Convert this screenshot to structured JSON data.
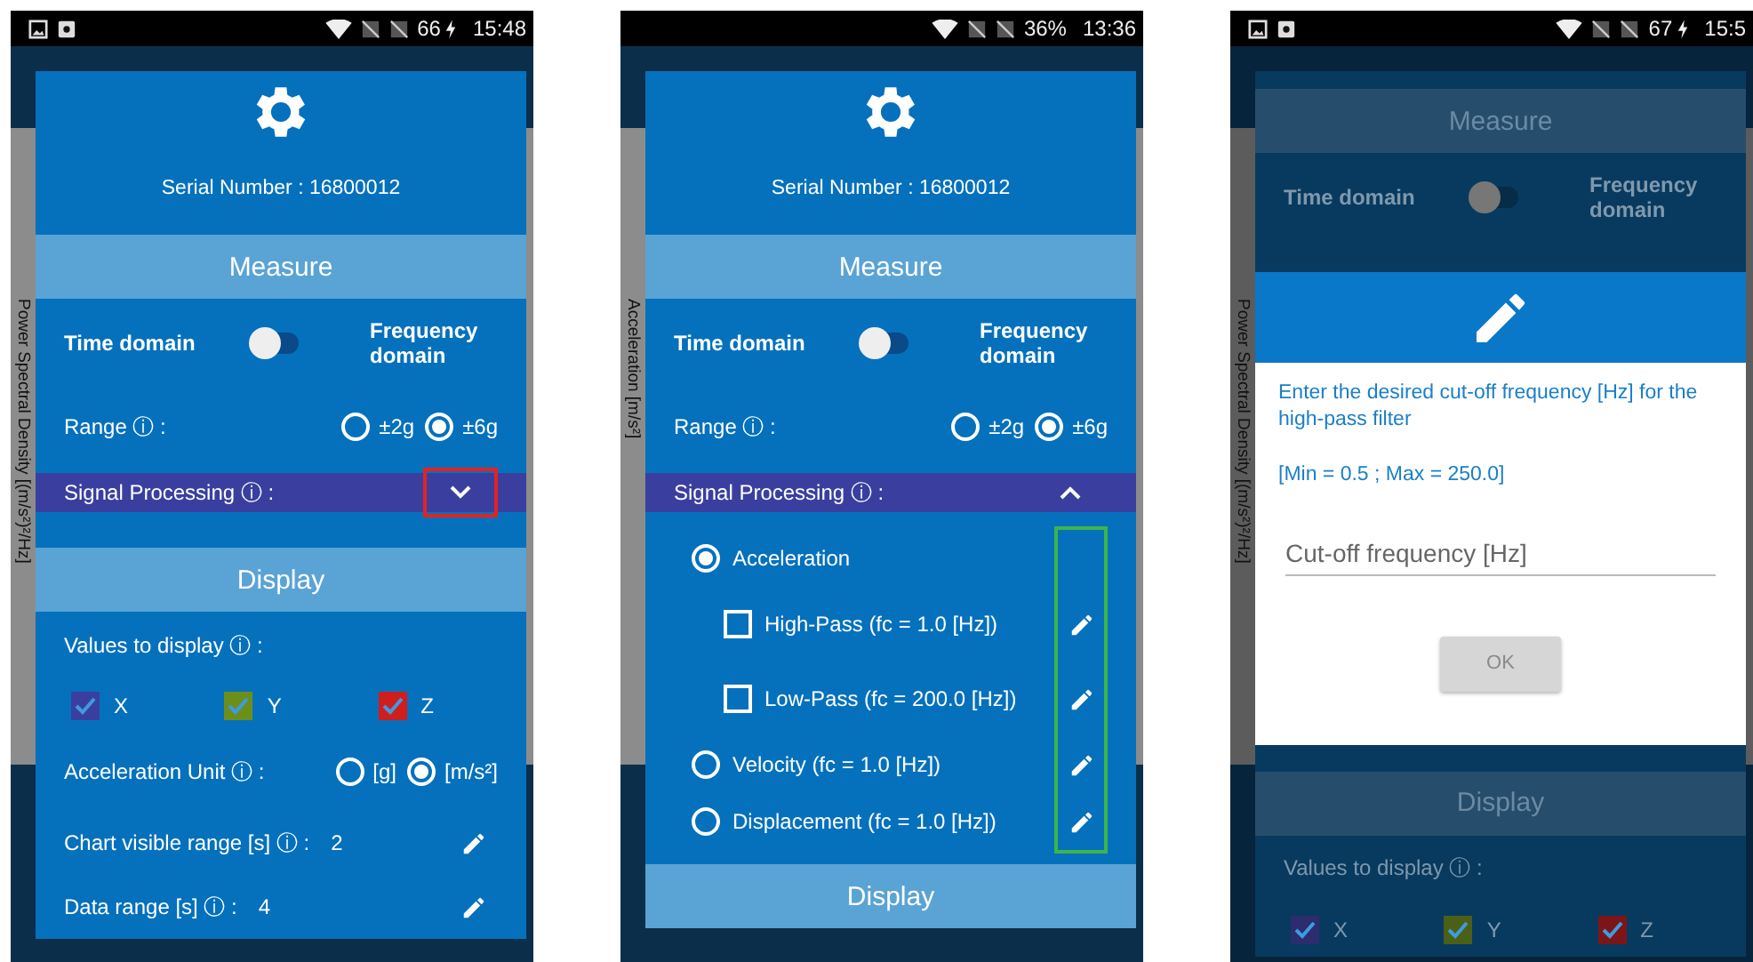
{
  "phones": [
    {
      "status": {
        "notification_icons": true,
        "battery": "66",
        "charging": true,
        "time": "15:48"
      },
      "axis_label": "Power Spectral Density [(m/s²)²/Hz]",
      "dimmed": false,
      "serial": "Serial Number : 16800012",
      "items": [
        {
          "kind": "header",
          "text": "Measure"
        },
        {
          "kind": "toggle",
          "left": "Time domain",
          "right": "Frequency domain",
          "on": false
        },
        {
          "kind": "radio_row",
          "label": "Range ⓘ :",
          "options": [
            {
              "label": "±2g",
              "selected": false
            },
            {
              "label": "±6g",
              "selected": true
            }
          ]
        },
        {
          "kind": "expander",
          "label": "Signal Processing ⓘ :",
          "expanded": false,
          "highlighted": true
        },
        {
          "kind": "header",
          "text": "Display"
        },
        {
          "kind": "label",
          "text": "Values to display ⓘ :"
        },
        {
          "kind": "checks",
          "items": [
            {
              "label": "X",
              "checked": true,
              "color": "#3a3f9f"
            },
            {
              "label": "Y",
              "checked": true,
              "color": "#6c8f1c"
            },
            {
              "label": "Z",
              "checked": true,
              "color": "#d01d1d"
            }
          ]
        },
        {
          "kind": "radio_row",
          "label": "Acceleration Unit ⓘ :",
          "options": [
            {
              "label": "[g]",
              "selected": false
            },
            {
              "label": "[m/s²]",
              "selected": true
            }
          ]
        },
        {
          "kind": "value",
          "label": "Chart visible range [s] ⓘ :",
          "value": "2",
          "editable": true
        },
        {
          "kind": "value",
          "label": "Data range [s] ⓘ :",
          "value": "4",
          "editable": true
        }
      ]
    },
    {
      "status": {
        "notification_icons": false,
        "battery": "36%",
        "charging": false,
        "time": "13:36"
      },
      "axis_label": "Acceleration [m/s²]",
      "dimmed": false,
      "serial": "Serial Number : 16800012",
      "items": [
        {
          "kind": "header",
          "text": "Measure"
        },
        {
          "kind": "toggle",
          "left": "Time domain",
          "right": "Frequency domain",
          "on": false
        },
        {
          "kind": "radio_row",
          "label": "Range ⓘ :",
          "options": [
            {
              "label": "±2g",
              "selected": false
            },
            {
              "label": "±6g",
              "selected": true
            }
          ]
        },
        {
          "kind": "expander",
          "label": "Signal Processing ⓘ :",
          "expanded": true,
          "highlighted": false,
          "edit_highlighted": true,
          "children": [
            {
              "kind": "radio",
              "label": "Acceleration",
              "selected": true,
              "editable": false
            },
            {
              "kind": "check",
              "label": "High-Pass (fc = 1.0 [Hz])",
              "checked": false,
              "editable": true
            },
            {
              "kind": "check",
              "label": "Low-Pass (fc = 200.0 [Hz])",
              "checked": false,
              "editable": true
            },
            {
              "kind": "radio",
              "label": "Velocity (fc = 1.0 [Hz])",
              "selected": false,
              "editable": true
            },
            {
              "kind": "radio",
              "label": "Displacement (fc = 1.0 [Hz])",
              "selected": false,
              "editable": true
            }
          ]
        },
        {
          "kind": "header",
          "text": "Display"
        }
      ]
    },
    {
      "status": {
        "notification_icons": true,
        "battery": "67",
        "charging": true,
        "time": "15:5"
      },
      "axis_label": "Power Spectral Density [(m/s²)²/Hz]",
      "dimmed": true,
      "items": [
        {
          "kind": "header",
          "text": "Measure"
        },
        {
          "kind": "toggle",
          "left": "Time domain",
          "right": "Frequency domain",
          "on": false
        },
        {
          "kind": "popup",
          "message": "Enter the desired cut-off frequency [Hz] for the high-pass filter",
          "limits": "[Min = 0.5 ; Max = 250.0]",
          "placeholder": "Cut-off frequency [Hz]",
          "button": {
            "label": "OK",
            "disabled": true
          }
        },
        {
          "kind": "header",
          "text": "Display"
        },
        {
          "kind": "label",
          "text": "Values to display ⓘ :"
        },
        {
          "kind": "checks",
          "items": [
            {
              "label": "X",
              "checked": true,
              "color": "#2c2c6e"
            },
            {
              "label": "Y",
              "checked": true,
              "color": "#4c5f16"
            },
            {
              "label": "Z",
              "checked": true,
              "color": "#7c1616"
            }
          ]
        }
      ]
    }
  ]
}
